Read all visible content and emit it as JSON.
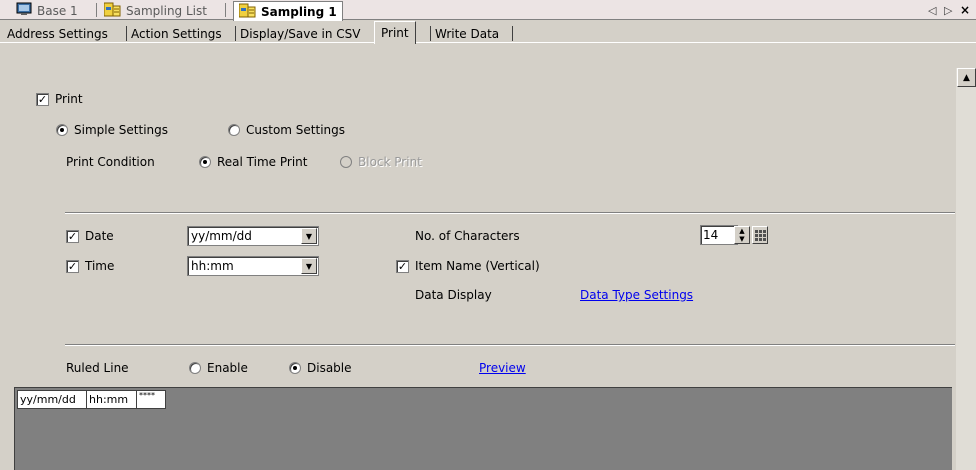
{
  "doc_tabs": [
    {
      "label": "Base 1",
      "icon": "screen-icon"
    },
    {
      "label": "Sampling List",
      "icon": "sampling-list-icon"
    },
    {
      "label": "Sampling 1",
      "icon": "sampling-icon"
    }
  ],
  "doc_nav": {
    "prev": "◁",
    "next": "▷",
    "close": "×"
  },
  "settings_tabs": [
    "Address Settings",
    "Action Settings",
    "Display/Save in CSV",
    "Print",
    "Write Data"
  ],
  "print": {
    "label": "Print",
    "checked": true,
    "mode_simple": "Simple Settings",
    "mode_custom": "Custom Settings",
    "mode_selected": "Simple Settings",
    "condition_label": "Print Condition",
    "condition_realtime": "Real Time Print",
    "condition_block": "Block Print"
  },
  "fields": {
    "date_label": "Date",
    "date_value": "yy/mm/dd",
    "time_label": "Time",
    "time_value": "hh:mm",
    "chars_label": "No. of Characters",
    "chars_value": "14",
    "item_name_label": "Item Name (Vertical)",
    "data_display_label": "Data Display",
    "data_type_link": "Data Type Settings"
  },
  "ruled_line": {
    "label": "Ruled Line",
    "enable": "Enable",
    "disable": "Disable",
    "selected": "Disable",
    "preview_link": "Preview"
  },
  "preview_cells": [
    "yy/mm/dd",
    "hh:mm",
    "****"
  ]
}
